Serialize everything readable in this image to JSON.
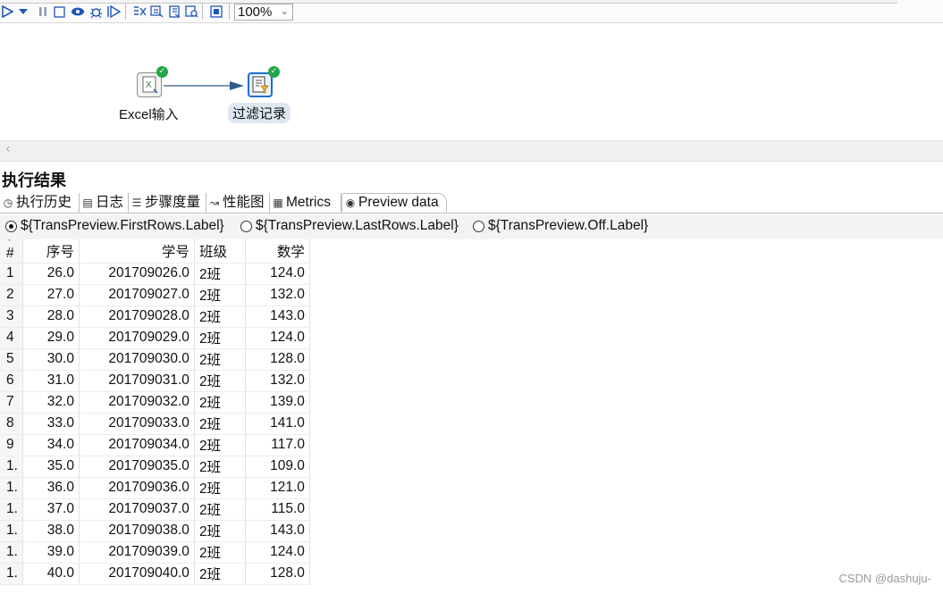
{
  "toolbar": {
    "zoom_value": "100%",
    "icons": [
      "run-icon",
      "run-options-icon",
      "pause-icon",
      "stop-icon",
      "preview-icon",
      "debug-icon",
      "replay-icon",
      "verify-icon",
      "impact-icon",
      "sql-icon",
      "explore-db-icon",
      "layout-icon"
    ]
  },
  "canvas": {
    "steps": [
      {
        "label": "Excel输入",
        "icon": "excel-input-icon",
        "status": "ok"
      },
      {
        "label": "过滤记录",
        "icon": "filter-rows-icon",
        "status": "ok"
      }
    ]
  },
  "results": {
    "title": "执行结果",
    "tabs": [
      {
        "label": "执行历史",
        "icon": "history-icon"
      },
      {
        "label": "日志",
        "icon": "log-icon"
      },
      {
        "label": "步骤度量",
        "icon": "step-metrics-icon"
      },
      {
        "label": "性能图",
        "icon": "performance-chart-icon"
      },
      {
        "label": "Metrics",
        "icon": "metrics-icon"
      },
      {
        "label": "Preview data",
        "icon": "preview-eye-icon",
        "active": true
      }
    ],
    "radio_options": [
      {
        "label": "${TransPreview.FirstRows.Label}",
        "selected": true
      },
      {
        "label": "${TransPreview.LastRows.Label}",
        "selected": false
      },
      {
        "label": "${TransPreview.Off.Label}",
        "selected": false
      }
    ]
  },
  "table": {
    "columns": [
      "#",
      "序号",
      "学号",
      "班级",
      "数学"
    ],
    "rows": [
      [
        "1",
        "26.0",
        "201709026.0",
        "2班",
        "124.0"
      ],
      [
        "2",
        "27.0",
        "201709027.0",
        "2班",
        "132.0"
      ],
      [
        "3",
        "28.0",
        "201709028.0",
        "2班",
        "143.0"
      ],
      [
        "4",
        "29.0",
        "201709029.0",
        "2班",
        "124.0"
      ],
      [
        "5",
        "30.0",
        "201709030.0",
        "2班",
        "128.0"
      ],
      [
        "6",
        "31.0",
        "201709031.0",
        "2班",
        "132.0"
      ],
      [
        "7",
        "32.0",
        "201709032.0",
        "2班",
        "139.0"
      ],
      [
        "8",
        "33.0",
        "201709033.0",
        "2班",
        "141.0"
      ],
      [
        "9",
        "34.0",
        "201709034.0",
        "2班",
        "117.0"
      ],
      [
        "1.",
        "35.0",
        "201709035.0",
        "2班",
        "109.0"
      ],
      [
        "1.",
        "36.0",
        "201709036.0",
        "2班",
        "121.0"
      ],
      [
        "1.",
        "37.0",
        "201709037.0",
        "2班",
        "115.0"
      ],
      [
        "1.",
        "38.0",
        "201709038.0",
        "2班",
        "143.0"
      ],
      [
        "1.",
        "39.0",
        "201709039.0",
        "2班",
        "124.0"
      ],
      [
        "1.",
        "40.0",
        "201709040.0",
        "2班",
        "128.0"
      ]
    ]
  },
  "watermark": "CSDN @dashuju-"
}
